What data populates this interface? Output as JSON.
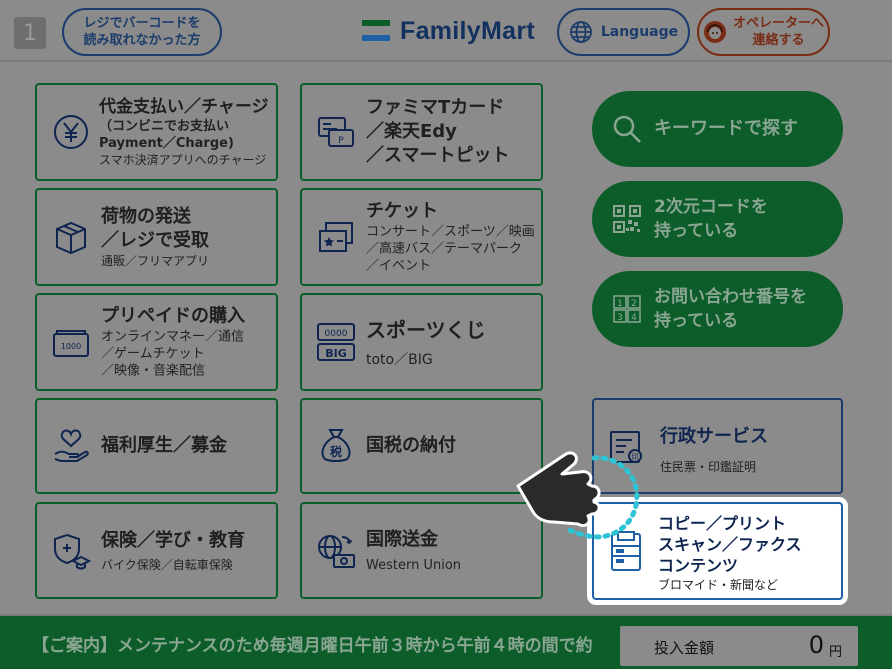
{
  "header": {
    "screen_number": "1",
    "barcode_help_label": "レジでバーコードを\n読み取れなかった方",
    "logo_text": "FamilyMart",
    "language_label": "Language",
    "operator_label": "オペレーターへ\n連絡する"
  },
  "services": {
    "payment": {
      "title": "代金支払い／チャージ",
      "sub1": "（コンビニでお支払い",
      "sub2": "Payment／Charge)",
      "sub3": "スマホ決済アプリへのチャージ"
    },
    "famima_card": {
      "title": "ファミマTカード\n／楽天Edy\n／スマートピット"
    },
    "parcel": {
      "title": "荷物の発送\n／レジで受取",
      "sub": "通販／フリマアプリ"
    },
    "ticket": {
      "title": "チケット",
      "sub": "コンサート／スポーツ／映画\n／高速バス／テーマパーク\n／イベント"
    },
    "prepaid": {
      "title": "プリペイドの購入",
      "sub": "オンラインマネー／通信\n／ゲームチケット\n／映像・音楽配信",
      "card_text": "1000"
    },
    "sports_lottery": {
      "title": "スポーツくじ",
      "sub": "toto／BIG",
      "icon_top": "0000",
      "icon_bottom": "BIG"
    },
    "welfare": {
      "title": "福利厚生／募金"
    },
    "tax": {
      "title": "国税の納付",
      "icon_text": "税"
    },
    "insurance": {
      "title": "保険／学び・教育",
      "sub": "バイク保険／自転車保険"
    },
    "remittance": {
      "title": "国際送金",
      "sub": "Western Union"
    }
  },
  "side_buttons": {
    "keyword_search": "キーワードで探す",
    "qr_code": "2次元コードを\n持っている",
    "inquiry_number": "お問い合わせ番号を\n持っている",
    "inquiry_icon_digits": [
      "1",
      "2",
      "3",
      "4"
    ]
  },
  "admin_service": {
    "title": "行政サービス",
    "sub": "住民票・印鑑証明"
  },
  "copy_print": {
    "title": "コピー／プリント\nスキャン／ファクス\nコンテンツ",
    "sub": "ブロマイド・新聞など"
  },
  "footer": {
    "ticker_text": "【ご案内】メンテナンスのため毎週月曜日午前３時から午前４時の間で約",
    "amount_label": "投入金額",
    "amount_value": "0",
    "amount_unit": "円"
  },
  "colors": {
    "dim_background": "#8b8b8b",
    "brand_green": "#0c5d29",
    "brand_navy": "#13315e",
    "brand_blue": "#1e88d0",
    "highlight_blue": "#1e5fa8",
    "pointer_ring": "#2ec4d6"
  },
  "icons": {
    "payment": "yen-coin-icon",
    "famima_card": "cards-icon",
    "parcel": "box-icon",
    "ticket": "ticket-icon",
    "prepaid": "prepaid-card-icon",
    "sports_lottery": "lottery-icon",
    "welfare": "heart-hand-icon",
    "tax": "money-bag-icon",
    "insurance": "shield-graduation-icon",
    "remittance": "globe-money-icon",
    "keyword_search": "search-icon",
    "qr_code": "qr-code-icon",
    "inquiry_number": "number-grid-icon",
    "admin_service": "certificate-icon",
    "copy_print": "printer-icon",
    "language": "globe-icon",
    "operator": "operator-icon",
    "pointer": "pointing-hand-icon"
  }
}
